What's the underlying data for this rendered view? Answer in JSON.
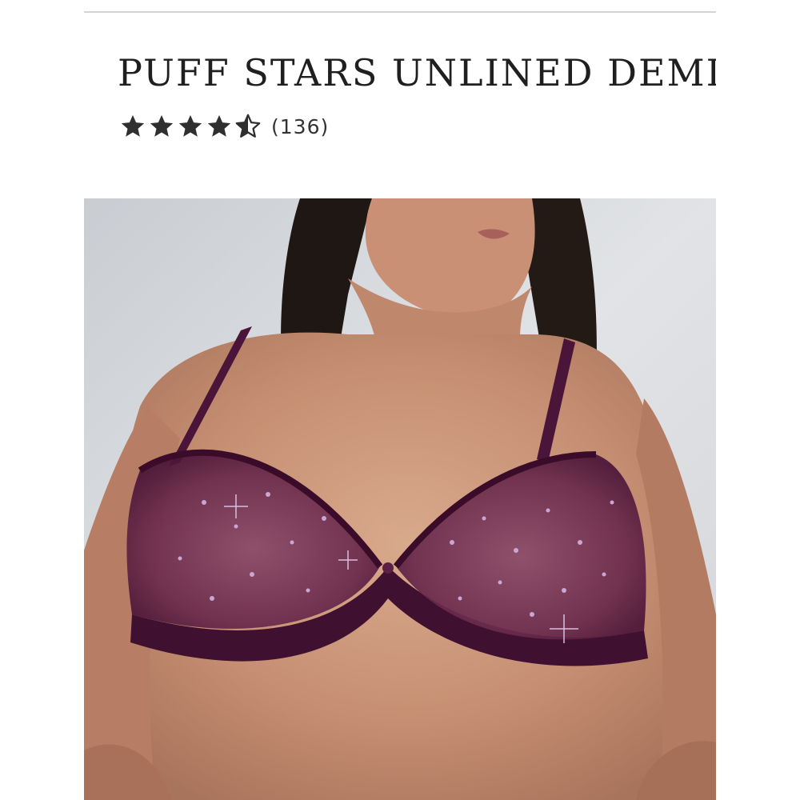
{
  "product": {
    "title": "PUFF STARS UNLINED DEMI",
    "rating": {
      "stars": 4.5,
      "max_stars": 5,
      "review_count_label": "(136)"
    }
  },
  "colors": {
    "star_fill": "#2f2f2f",
    "garment": "#4a1538",
    "background": "#ffffff",
    "divider": "#d4d4d4"
  },
  "photo": {
    "icon": "product-photo"
  }
}
